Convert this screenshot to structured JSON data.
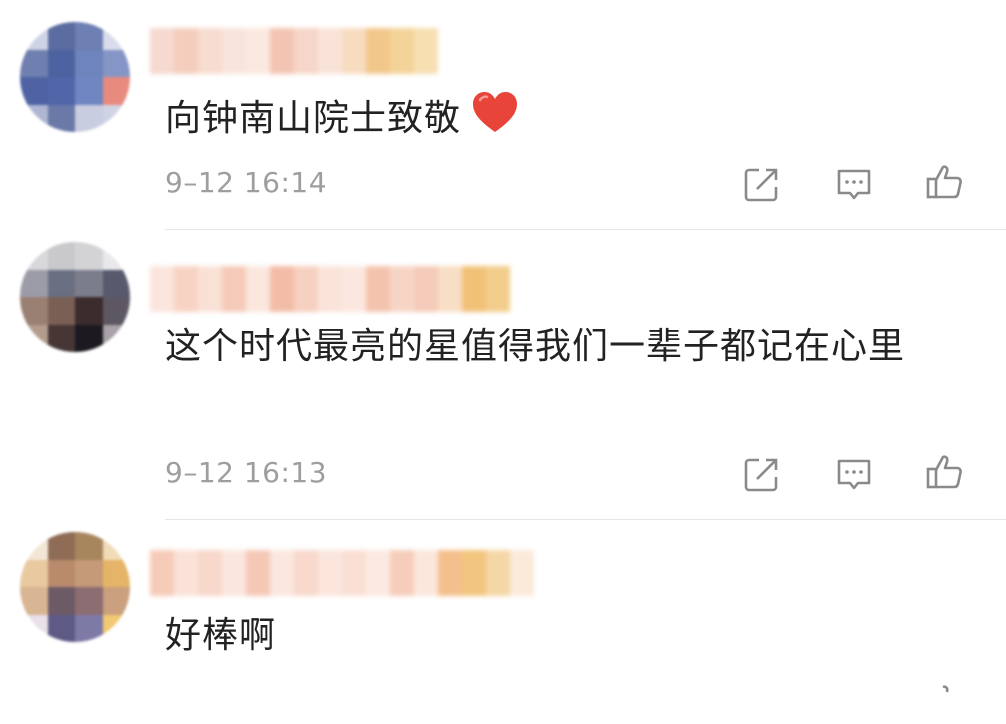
{
  "comments": [
    {
      "text": "向钟南山院士致敬",
      "emoji": "heart",
      "time": "9–12 16:14",
      "icons": {
        "share": "share-icon",
        "reply": "comment-icon",
        "like": "thumbs-up-icon"
      }
    },
    {
      "text": "这个时代最亮的星值得我们一辈子都记在心里",
      "time": "9–12 16:13",
      "icons": {
        "share": "share-icon",
        "reply": "comment-icon",
        "like": "thumbs-up-icon"
      }
    },
    {
      "text": "好棒啊",
      "icons": {
        "share": "share-icon",
        "reply": "comment-icon",
        "like": "thumbs-up-icon"
      }
    }
  ],
  "colors": {
    "text": "#222222",
    "meta": "#9e9e9e",
    "icon": "#8a8a8a",
    "heart": "#e8443a"
  }
}
